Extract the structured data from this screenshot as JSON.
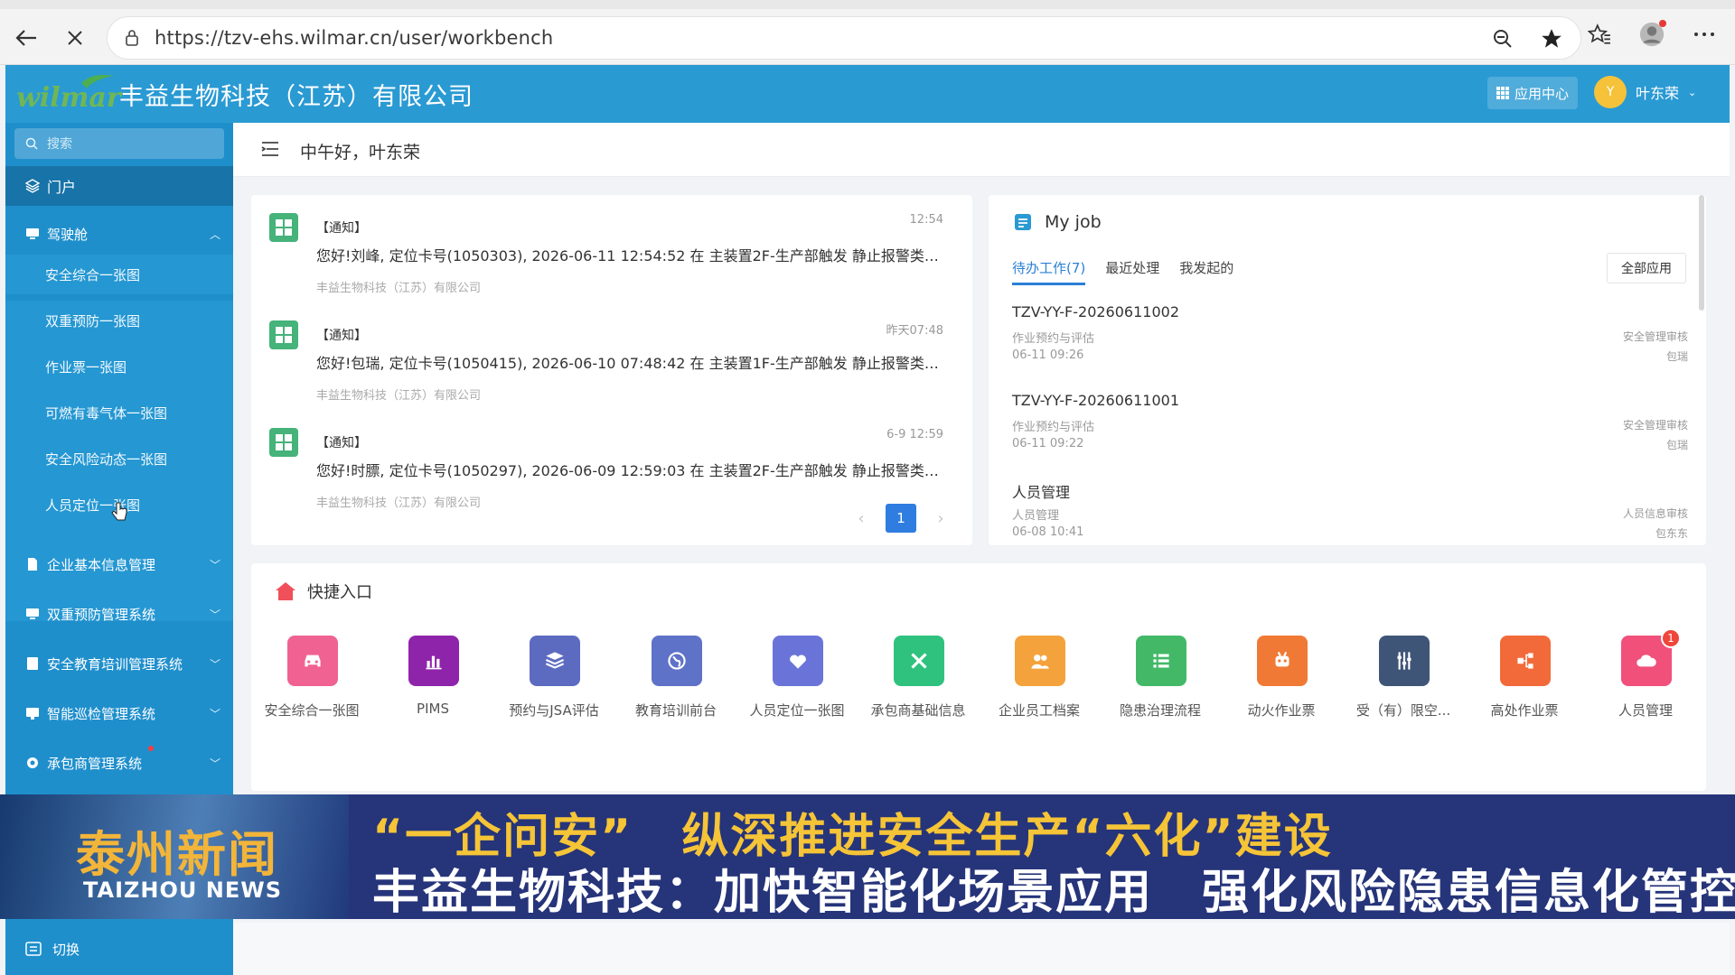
{
  "browser": {
    "url": "https://tzv-ehs.wilmar.cn/user/workbench"
  },
  "header": {
    "logo_text": "wilmar",
    "company": "丰益生物科技（江苏）有限公司",
    "app_center": "应用中心",
    "user_name": "叶东荣",
    "avatar_initial": "Y"
  },
  "sidebar": {
    "search_placeholder": "搜索",
    "portal": "门户",
    "cockpit": "驾驶舱",
    "sub_items": [
      {
        "label": "安全综合一张图"
      },
      {
        "label": "双重预防一张图"
      },
      {
        "label": "作业票一张图"
      },
      {
        "label": "可燃有毒气体一张图"
      },
      {
        "label": "安全风险动态一张图"
      },
      {
        "label": "人员定位一张图"
      }
    ],
    "groups": [
      {
        "label": "企业基本信息管理"
      },
      {
        "label": "双重预防管理系统"
      },
      {
        "label": "安全教育培训管理系统"
      },
      {
        "label": "智能巡检管理系统"
      },
      {
        "label": "承包商管理系统"
      }
    ],
    "footer": "切换"
  },
  "main": {
    "greeting": "中午好，叶东荣"
  },
  "notices": {
    "items": [
      {
        "tag": "【通知】",
        "time": "12:54",
        "body": "您好!刘峰, 定位卡号(1050303), 2026-06-11 12:54:52 在 主装置2F-生产部触发 静止报警类型报...",
        "org": "丰益生物科技（江苏）有限公司"
      },
      {
        "tag": "【通知】",
        "time": "昨天07:48",
        "body": "您好!包瑞, 定位卡号(1050415), 2026-06-10 07:48:42 在 主装置1F-生产部触发 静止报警类型报...",
        "org": "丰益生物科技（江苏）有限公司"
      },
      {
        "tag": "【通知】",
        "time": "6-9 12:59",
        "body": "您好!时膘, 定位卡号(1050297), 2026-06-09 12:59:03 在 主装置2F-生产部触发 静止报警类型报...",
        "org": "丰益生物科技（江苏）有限公司"
      }
    ],
    "page": "1",
    "prev": "‹",
    "next": "›"
  },
  "job": {
    "title": "My job",
    "tabs": [
      {
        "label": "待办工作(7)"
      },
      {
        "label": "最近处理"
      },
      {
        "label": "我发起的"
      }
    ],
    "all_apps": "全部应用",
    "items": [
      {
        "code": "TZV-YY-F-20260611002",
        "type": "作业预约与评估",
        "date": "06-11 09:26",
        "status": "安全管理审核",
        "person": "包瑞"
      },
      {
        "code": "TZV-YY-F-20260611001",
        "type": "作业预约与评估",
        "date": "06-11 09:22",
        "status": "安全管理审核",
        "person": "包瑞"
      },
      {
        "code": "人员管理",
        "type": "人员管理",
        "date": "06-08 10:41",
        "status": "人员信息审核",
        "person": "包东东"
      }
    ]
  },
  "quick": {
    "title": "快捷入口",
    "items": [
      {
        "label": "安全综合一张图",
        "color": "#f06292",
        "icon": "car-icon"
      },
      {
        "label": "PIMS",
        "color": "#8e24aa",
        "icon": "chart-icon"
      },
      {
        "label": "预约与JSA评估",
        "color": "#5c6bc0",
        "icon": "layers-icon"
      },
      {
        "label": "教育培训前台",
        "color": "#5e72c8",
        "icon": "globe-icon"
      },
      {
        "label": "人员定位一张图",
        "color": "#6a74d8",
        "icon": "heart-icon"
      },
      {
        "label": "承包商基础信息",
        "color": "#2ec27e",
        "icon": "tools-icon"
      },
      {
        "label": "企业员工档案",
        "color": "#f4a23c",
        "icon": "people-icon"
      },
      {
        "label": "隐患治理流程",
        "color": "#43b968",
        "icon": "list-icon"
      },
      {
        "label": "动火作业票",
        "color": "#f07a35",
        "icon": "robot-icon"
      },
      {
        "label": "受（有）限空...",
        "color": "#3f5577",
        "icon": "sliders-icon"
      },
      {
        "label": "高处作业票",
        "color": "#f26a3a",
        "icon": "flow-icon"
      },
      {
        "label": "人员管理",
        "color": "#f0507a",
        "icon": "cloud-icon",
        "badge": "1"
      }
    ]
  },
  "news": {
    "channel_cn": "泰州新闻",
    "channel_en": "TAIZHOU NEWS",
    "headline1": "“一企问安”　纵深推进安全生产“六化”建设",
    "headline2": "丰益生物科技：加快智能化场景应用　强化风险隐患信息化管控"
  }
}
